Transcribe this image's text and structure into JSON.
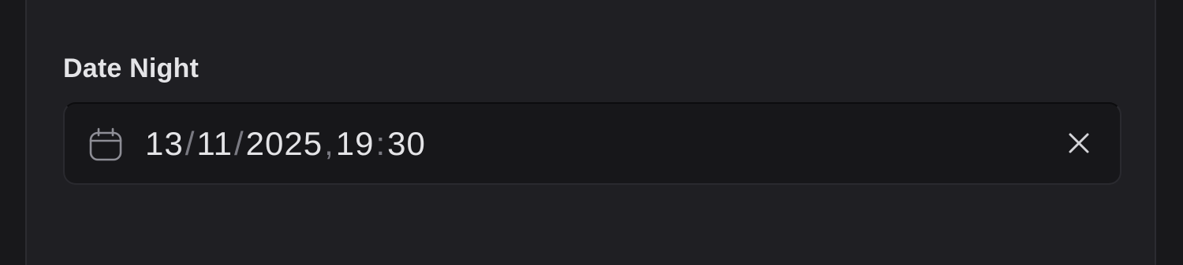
{
  "field": {
    "label": "Date Night",
    "day": "13",
    "month": "11",
    "year": "2025",
    "hour": "19",
    "minute": "30",
    "date_separator": "/",
    "datetime_separator": ",",
    "time_separator": ":"
  },
  "icons": {
    "leading": "calendar-icon",
    "trailing": "close-icon"
  },
  "colors": {
    "background": "#18181b",
    "panel": "#1f1f23",
    "input_background": "#17171a",
    "text": "#e4e4e7",
    "muted": "#7a7a82"
  }
}
